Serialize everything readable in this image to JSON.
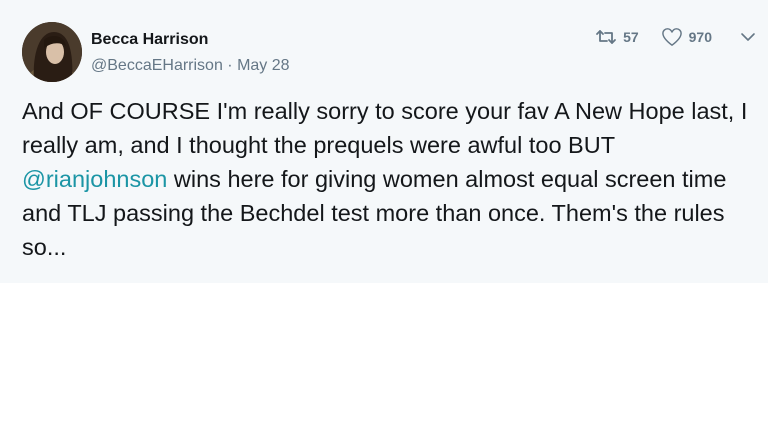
{
  "tweet": {
    "author_name": "Becca Harrison",
    "author_handle": "@BeccaEHarrison",
    "separator": "·",
    "date": "May 28",
    "text_before": "And OF COURSE I'm really sorry to score your fav A New Hope last, I really am, and I thought the prequels were awful too BUT ",
    "mention": "@rianjohnson",
    "text_after": " wins here for giving women almost equal screen time and TLJ passing the Bechdel test more than once. Them's the rules so..."
  },
  "actions": {
    "retweets": {
      "icon": "retweet-icon",
      "count": "57"
    },
    "likes": {
      "icon": "heart-icon",
      "count": "970"
    },
    "menu": {
      "icon": "chevron-down-icon"
    }
  },
  "colors": {
    "background": "#f5f8fa",
    "text": "#14171a",
    "muted": "#657786",
    "mention": "#1b95a5"
  }
}
